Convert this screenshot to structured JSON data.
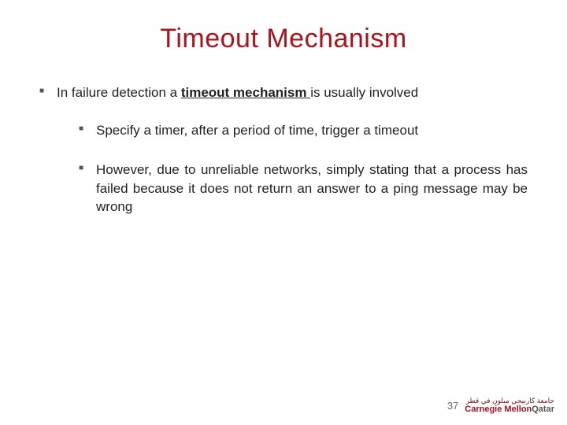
{
  "title": "Timeout Mechanism",
  "intro": {
    "prefix": "In failure detection a ",
    "keyword": "timeout mechanism ",
    "suffix": "is usually involved"
  },
  "bullets": {
    "b1": "Specify a timer, after a period of time, trigger a timeout",
    "b2": "However, due to unreliable networks, simply stating that a process has failed because it does not return an answer to a ping message may be wrong"
  },
  "page_number": "37",
  "logo": {
    "arabic": "جامعة كارنيجي ميلون في قطر",
    "english_part1": "Carnegie Mellon",
    "english_part2": "Qatar"
  }
}
